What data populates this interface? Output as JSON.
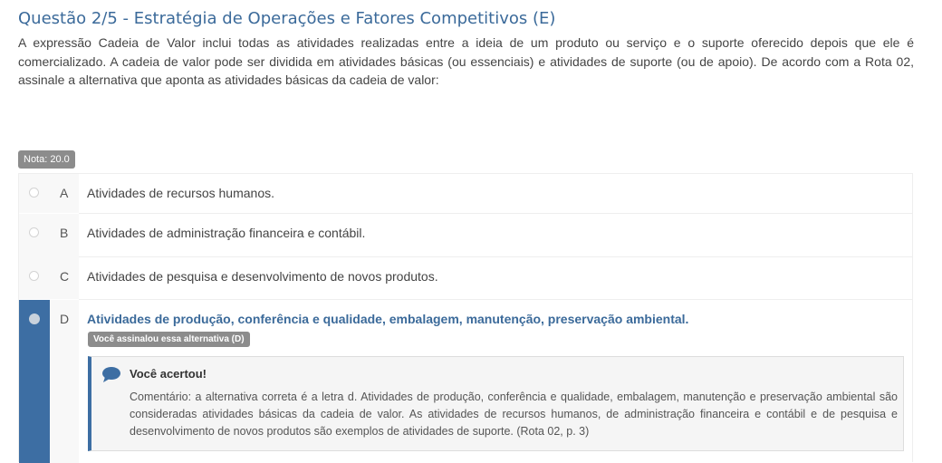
{
  "question": {
    "title": "Questão 2/5 - Estratégia de Operações e Fatores Competitivos (E)",
    "statement": "A expressão Cadeia de Valor inclui todas as atividades realizadas entre a ideia de um produto ou serviço e o suporte oferecido depois que ele é comercializado. A cadeia de valor pode ser dividida em atividades básicas (ou essenciais) e atividades de suporte (ou de apoio). De acordo com a Rota 02, assinale a alternativa que aponta as atividades básicas da cadeia de valor:",
    "grade": "Nota: 20.0"
  },
  "options": [
    {
      "letter": "A",
      "text": "Atividades de recursos humanos."
    },
    {
      "letter": "B",
      "text": "Atividades de administração financeira e contábil."
    },
    {
      "letter": "C",
      "text": "Atividades de pesquisa e desenvolvimento de novos produtos."
    },
    {
      "letter": "D",
      "text": "Atividades de produção, conferência e qualidade, embalagem, manutenção, preservação ambiental.",
      "selected": true
    }
  ],
  "selected_badge": "Você assinalou essa alternativa (D)",
  "feedback": {
    "icon": "speech-bubble-icon",
    "title": "Você acertou!",
    "comment": "Comentário: a alternativa correta é a letra d. Atividades de produção, conferência e qualidade, embalagem, manutenção e preservação ambiental são consideradas atividades básicas da cadeia de valor. As atividades de recursos humanos, de administração financeira e contábil e de pesquisa e desenvolvimento de novos produtos são exemplos de atividades de suporte. (Rota 02, p. 3)"
  },
  "colors": {
    "accent": "#3d6ea3",
    "title": "#3b6a9a",
    "badge": "#8c8c8c"
  }
}
